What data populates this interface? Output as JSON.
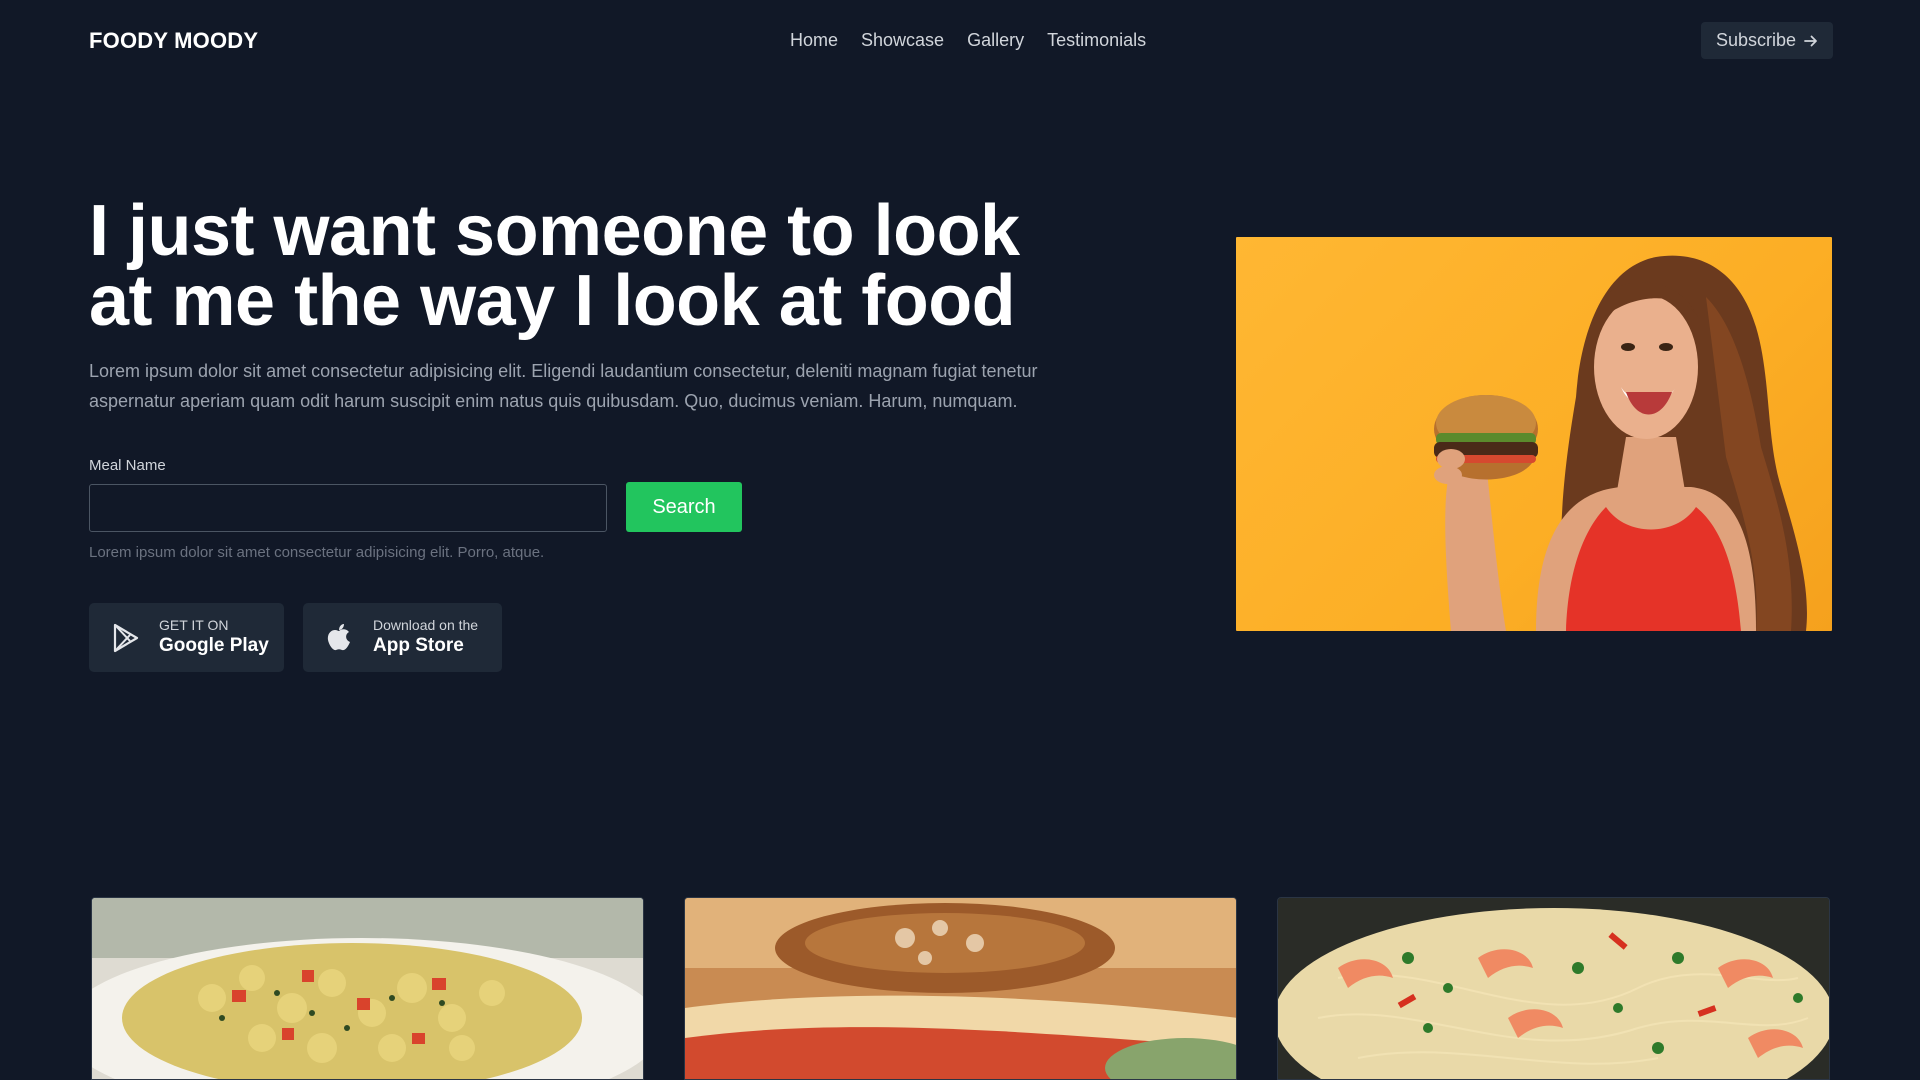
{
  "header": {
    "logo": "FOODY MOODY",
    "nav": [
      "Home",
      "Showcase",
      "Gallery",
      "Testimonials"
    ],
    "subscribe_label": "Subscribe",
    "subscribe_icon": "arrow-right-icon"
  },
  "hero": {
    "title": "I just want someone to look at me the way I look at food",
    "description": "Lorem ipsum dolor sit amet consectetur adipisicing elit. Eligendi laudantium consectetur, deleniti magnam fugiat tenetur aspernatur aperiam quam odit harum suscipit enim natus quis quibusdam. Quo, ducimus veniam. Harum, numquam."
  },
  "search": {
    "label": "Meal Name",
    "value": "",
    "placeholder": "",
    "button_label": "Search",
    "helper_text": "Lorem ipsum dolor sit amet consectetur adipisicing elit. Porro, atque."
  },
  "stores": [
    {
      "small": "GET IT ON",
      "big": "Google Play",
      "icon": "google-play-icon"
    },
    {
      "small": "Download on the",
      "big": "App Store",
      "icon": "apple-icon"
    }
  ],
  "colors": {
    "background": "#111827",
    "accent_green": "#22c55e",
    "surface": "#1f2937",
    "hero_image_bg": "#fcae25"
  }
}
